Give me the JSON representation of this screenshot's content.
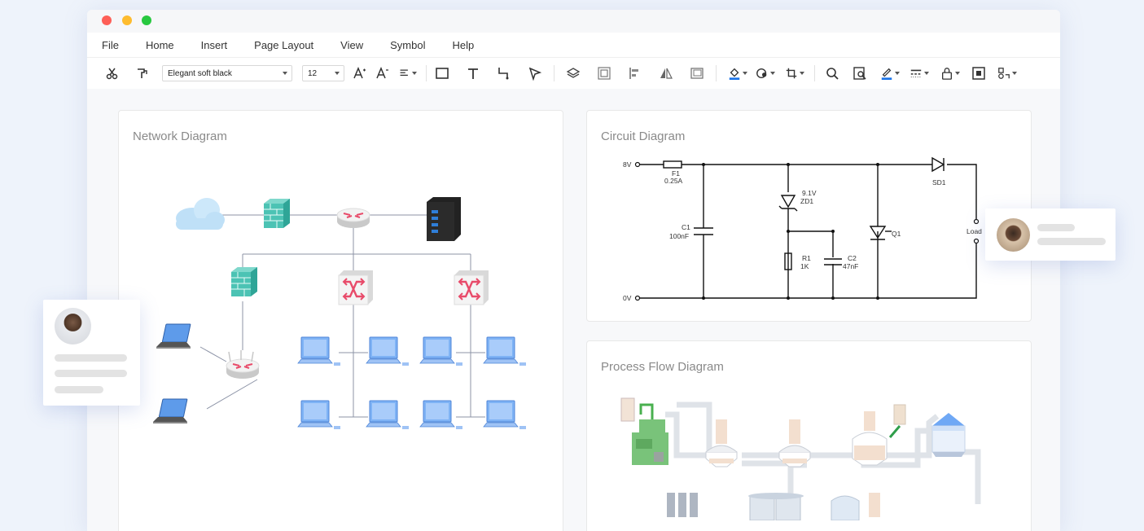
{
  "window": {
    "traffic_lights": [
      "#fe5f57",
      "#febc2e",
      "#28c840"
    ]
  },
  "menu": [
    "File",
    "Home",
    "Insert",
    "Page Layout",
    "View",
    "Symbol",
    "Help"
  ],
  "toolbar": {
    "font_family": "Elegant soft black",
    "font_size": "12",
    "accent_color": "#1a73e8",
    "icons": [
      "cut-icon",
      "format-painter-icon",
      "font-grow-icon",
      "font-shrink-icon",
      "align-text-icon",
      "rectangle-icon",
      "text-icon",
      "connector-icon",
      "pointer-icon",
      "layers-icon",
      "group-icon",
      "align-icon",
      "flip-icon",
      "frame-icon",
      "fill-icon",
      "shape-style-icon",
      "crop-icon",
      "search-icon",
      "find-replace-icon",
      "line-color-icon",
      "line-style-icon",
      "lock-icon",
      "fit-icon",
      "more-icon"
    ]
  },
  "cards": {
    "network": {
      "title": "Network Diagram"
    },
    "circuit": {
      "title": "Circuit Diagram",
      "labels": {
        "v8": "8V",
        "v0": "0V",
        "f1": "F1",
        "f1_val": "0.25A",
        "c1": "C1",
        "c1_val": "100nF",
        "zd1_volt": "9.1V",
        "zd1": "ZD1",
        "r1": "R1",
        "r1_val": "1K",
        "c2": "C2",
        "c2_val": "47nF",
        "q1": "Q1",
        "sd1": "SD1",
        "load": "Load"
      }
    },
    "process": {
      "title": "Process Flow Diagram"
    }
  },
  "colors": {
    "firewall": "#3fb7a8",
    "router_arrows": "#e84b6a",
    "computer": "#6fa8f5",
    "cloud": "#bfe0f7",
    "tank": "#f3dfcf",
    "pipe": "#dfe3e8"
  }
}
